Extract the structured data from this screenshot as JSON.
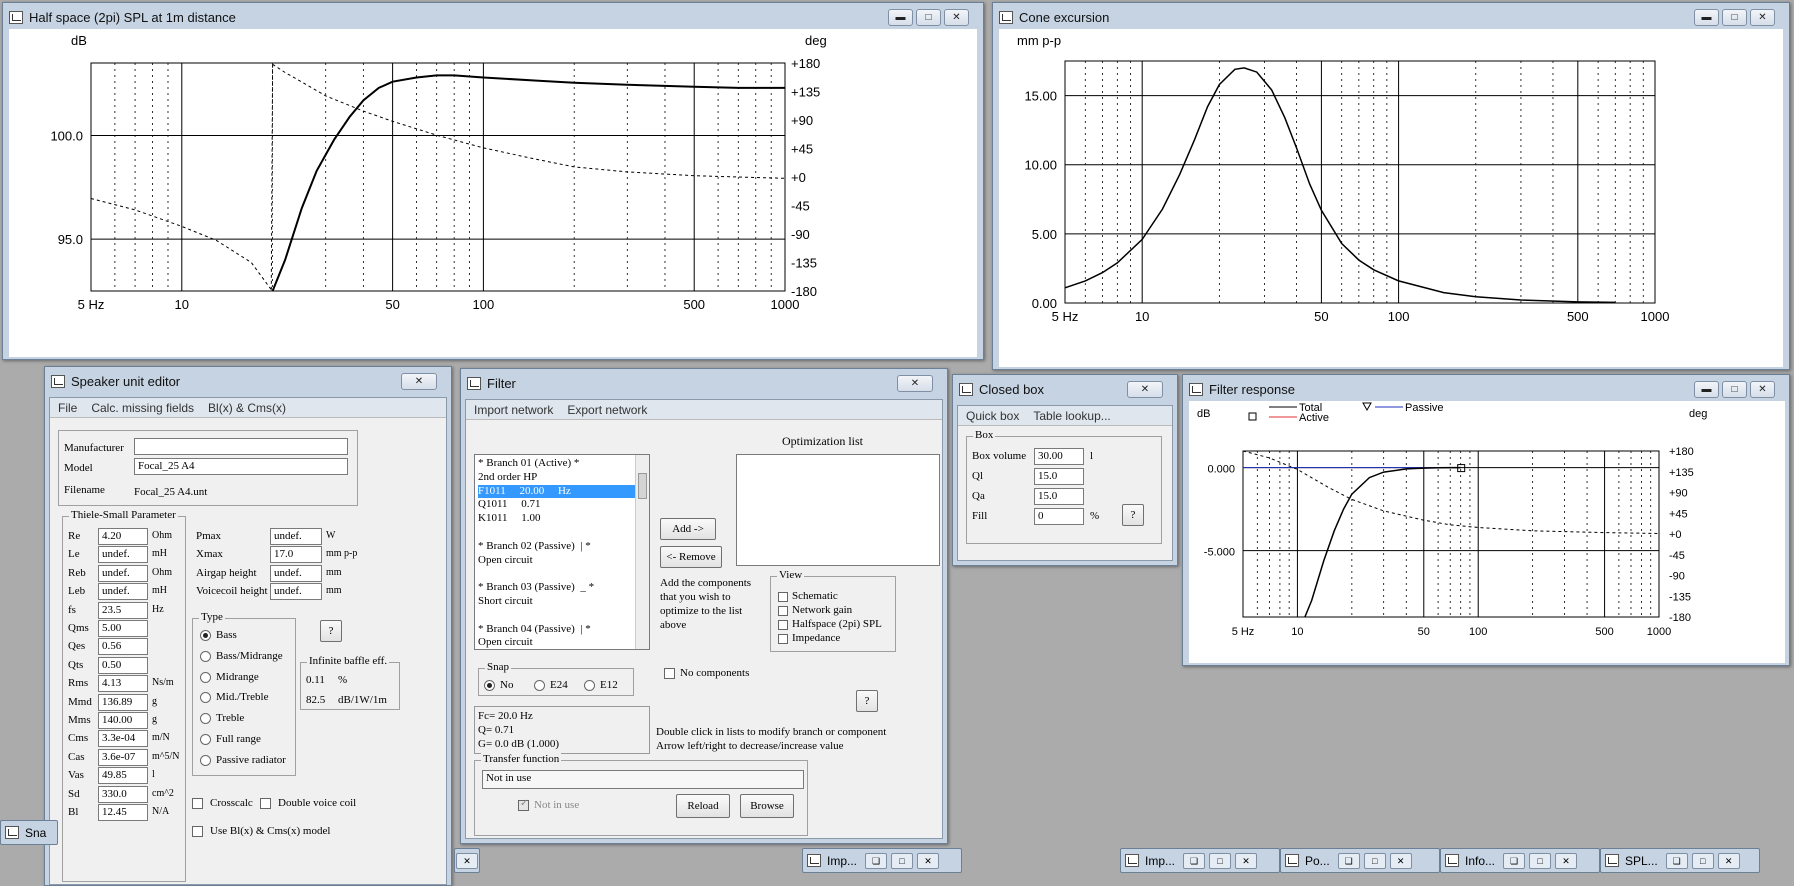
{
  "spl": {
    "title": "Half space (2pi) SPL at 1m distance",
    "ylabel": "dB",
    "y2label": "deg",
    "yticks": [
      "100.0",
      "95.0"
    ],
    "y2ticks": [
      "+180",
      "+135",
      "+90",
      "+45",
      "+0",
      "-45",
      "-90",
      "-135",
      "-180"
    ],
    "xticks": [
      "5 Hz",
      "10",
      "50",
      "100",
      "500",
      "1000"
    ]
  },
  "cone": {
    "title": "Cone excursion",
    "ylabel": "mm p-p",
    "yticks": [
      "15.00",
      "10.00",
      "5.00",
      "0.00"
    ],
    "xticks": [
      "5 Hz",
      "10",
      "50",
      "100",
      "500",
      "1000"
    ]
  },
  "fresp": {
    "title": "Filter response",
    "ylabel": "dB",
    "y2label": "deg",
    "yticks": [
      "0.000",
      "-5.000"
    ],
    "y2ticks": [
      "+180",
      "+135",
      "+90",
      "+45",
      "+0",
      "-45",
      "-90",
      "-135",
      "-180"
    ],
    "xticks": [
      "5 Hz",
      "10",
      "50",
      "100",
      "500",
      "1000"
    ],
    "legend": {
      "total": "Total",
      "active": "Active",
      "passive": "Passive"
    }
  },
  "chart_data": [
    {
      "type": "line",
      "title": "Half space (2pi) SPL at 1m distance",
      "ylabel": "dB",
      "y2label": "deg",
      "xscale": "log",
      "xlim": [
        5,
        1000
      ],
      "ylim": [
        92.5,
        103.5
      ],
      "y2lim": [
        -180,
        180
      ],
      "series": [
        {
          "x": [
            20,
            22,
            25,
            28,
            32,
            36,
            40,
            45,
            50,
            60,
            70,
            80,
            90,
            100,
            150,
            200,
            300,
            500,
            700,
            1000
          ],
          "y": [
            92.5,
            94,
            96.5,
            98.3,
            99.8,
            100.9,
            101.7,
            102.3,
            102.6,
            102.8,
            102.9,
            102.9,
            102.85,
            102.8,
            102.65,
            102.55,
            102.45,
            102.35,
            102.3,
            102.3
          ]
        },
        {
          "axis": "y2",
          "x": [
            5,
            7,
            10,
            13,
            17,
            19.8,
            20,
            22,
            25,
            30,
            40,
            50,
            70,
            100,
            150,
            200,
            300,
            500,
            700,
            1000
          ],
          "y": [
            -34,
            -52,
            -78,
            -100,
            -135,
            -178,
            178,
            165,
            150,
            128,
            104,
            88,
            66,
            46,
            28,
            16,
            8,
            2,
            0,
            -2
          ]
        }
      ]
    },
    {
      "type": "line",
      "title": "Cone excursion",
      "ylabel": "mm p-p",
      "xscale": "log",
      "xlim": [
        5,
        1000
      ],
      "ylim": [
        0,
        17.5
      ],
      "series": [
        {
          "x": [
            5,
            6,
            7,
            8,
            10,
            12,
            14,
            16,
            18,
            20,
            23,
            25,
            28,
            32,
            36,
            40,
            45,
            50,
            60,
            70,
            80,
            100,
            150,
            200,
            300,
            500,
            700
          ],
          "y": [
            1.1,
            1.6,
            2.2,
            2.9,
            4.6,
            6.8,
            9.3,
            11.8,
            14.2,
            15.8,
            16.9,
            17.0,
            16.7,
            15.4,
            13.4,
            11.2,
            8.6,
            6.7,
            4.3,
            3.1,
            2.4,
            1.6,
            0.75,
            0.45,
            0.22,
            0.08,
            0.04
          ]
        }
      ]
    },
    {
      "type": "line",
      "title": "Filter response",
      "ylabel": "dB",
      "y2label": "deg",
      "xscale": "log",
      "xlim": [
        5,
        1000
      ],
      "ylim": [
        -9,
        1
      ],
      "y2lim": [
        -180,
        180
      ],
      "legend": [
        "Total",
        "Active",
        "Passive"
      ],
      "series": [
        {
          "name": "Total",
          "x": [
            11,
            12,
            14,
            16,
            18,
            20,
            25,
            30,
            40,
            50,
            60,
            70,
            80
          ],
          "y": [
            -9,
            -8,
            -5.6,
            -3.8,
            -2.5,
            -1.6,
            -0.6,
            -0.27,
            -0.08,
            -0.03,
            -0.01,
            0,
            0
          ]
        },
        {
          "name": "Passive",
          "x": [
            5,
            50,
            80
          ],
          "y": [
            0,
            0,
            0
          ]
        },
        {
          "axis": "y2",
          "x": [
            5,
            7,
            10,
            15,
            20,
            30,
            50,
            70,
            100,
            200,
            500,
            1000
          ],
          "y": [
            180,
            165,
            140,
            100,
            75,
            50,
            30,
            20,
            14,
            7,
            3,
            1
          ]
        }
      ]
    }
  ],
  "editor": {
    "title": "Speaker unit editor",
    "menu": [
      "File",
      "Calc. missing fields",
      "Bl(x) & Cms(x)"
    ],
    "manufacturer_label": "Manufacturer",
    "manufacturer": "",
    "model_label": "Model",
    "model": "Focal_25 A4",
    "filename_label": "Filename",
    "filename": "Focal_25 A4.unt",
    "ts_title": "Thiele-Small Parameter",
    "params": [
      {
        "n": "Re",
        "v": "4.20",
        "u": "Ohm"
      },
      {
        "n": "Le",
        "v": "undef.",
        "u": "mH"
      },
      {
        "n": "Reb",
        "v": "undef.",
        "u": "Ohm"
      },
      {
        "n": "Leb",
        "v": "undef.",
        "u": "mH"
      },
      {
        "n": "fs",
        "v": "23.5",
        "u": "Hz"
      },
      {
        "n": "Qms",
        "v": "5.00",
        "u": ""
      },
      {
        "n": "Qes",
        "v": "0.56",
        "u": ""
      },
      {
        "n": "Qts",
        "v": "0.50",
        "u": ""
      },
      {
        "n": "Rms",
        "v": "4.13",
        "u": "Ns/m"
      },
      {
        "n": "Mmd",
        "v": "136.89",
        "u": "g"
      },
      {
        "n": "Mms",
        "v": "140.00",
        "u": "g"
      },
      {
        "n": "Cms",
        "v": "3.3e-04",
        "u": "m/N"
      },
      {
        "n": "Cas",
        "v": "3.6e-07",
        "u": "m^5/N"
      },
      {
        "n": "Vas",
        "v": "49.85",
        "u": "l"
      },
      {
        "n": "Sd",
        "v": "330.0",
        "u": "cm^2"
      },
      {
        "n": "Bl",
        "v": "12.45",
        "u": "N/A"
      }
    ],
    "params2": [
      {
        "n": "Pmax",
        "v": "undef.",
        "u": "W"
      },
      {
        "n": "Xmax",
        "v": "17.0",
        "u": "mm p-p"
      },
      {
        "n": "Airgap height",
        "v": "undef.",
        "u": "mm"
      },
      {
        "n": "Voicecoil height",
        "v": "undef.",
        "u": "mm"
      }
    ],
    "type_title": "Type",
    "types": [
      "Bass",
      "Bass/Midrange",
      "Midrange",
      "Mid./Treble",
      "Treble",
      "Full range",
      "Passive radiator"
    ],
    "help": "?",
    "ib_title": "Infinite baffle eff.",
    "ib_eff": "0.11",
    "ib_eff_u": "%",
    "ib_spl": "82.5",
    "ib_spl_u": "dB/1W/1m",
    "crosscalc": "Crosscalc",
    "double_vc": "Double voice coil",
    "blx_model": "Use Bl(x) & Cms(x) model"
  },
  "filter": {
    "title": "Filter",
    "menu": [
      "Import network",
      "Export network"
    ],
    "branches": [
      "* Branch 01 (Active) *",
      "2nd order HP",
      "F1011     20.00     Hz",
      "Q1011     0.71",
      "K1011     1.00",
      "",
      "* Branch 02 (Passive)  | *",
      "Open circuit",
      "",
      "* Branch 03 (Passive)  _ *",
      "Short circuit",
      "",
      "* Branch 04 (Passive)  | *",
      "Open circuit"
    ],
    "opt_title": "Optimization list",
    "add": "Add ->",
    "remove": "<- Remove",
    "add_note": "Add the components that you wish to optimize to the list above",
    "view_title": "View",
    "views": [
      "Schematic",
      "Network gain",
      "Halfspace (2pi) SPL",
      "Impedance"
    ],
    "snap_title": "Snap",
    "snaps": [
      "No",
      "E24",
      "E12"
    ],
    "no_components": "No components",
    "help": "?",
    "fc": "Fc=      20.0 Hz",
    "q": "Q=       0.71",
    "g": "G=       0.0 dB (1.000)",
    "hint1": "Double click in lists to modify branch or component",
    "hint2": "Arrow left/right to decrease/increase value",
    "tf_title": "Transfer function",
    "tf_value": "Not in use",
    "tf_check": "Not in use",
    "reload": "Reload",
    "browse": "Browse"
  },
  "closed": {
    "title": "Closed box",
    "menu": [
      "Quick box",
      "Table lookup..."
    ],
    "box_title": "Box",
    "fields": [
      {
        "n": "Box volume",
        "v": "30.00",
        "u": "l"
      },
      {
        "n": "Ql",
        "v": "15.0",
        "u": ""
      },
      {
        "n": "Qa",
        "v": "15.0",
        "u": ""
      },
      {
        "n": "Fill",
        "v": "0",
        "u": "%"
      }
    ],
    "help": "?"
  },
  "taskbar": [
    {
      "label": "Sna"
    },
    {
      "label": "Imp..."
    },
    {
      "label": "Imp..."
    },
    {
      "label": "Po..."
    },
    {
      "label": "Info..."
    },
    {
      "label": "SPL..."
    }
  ]
}
